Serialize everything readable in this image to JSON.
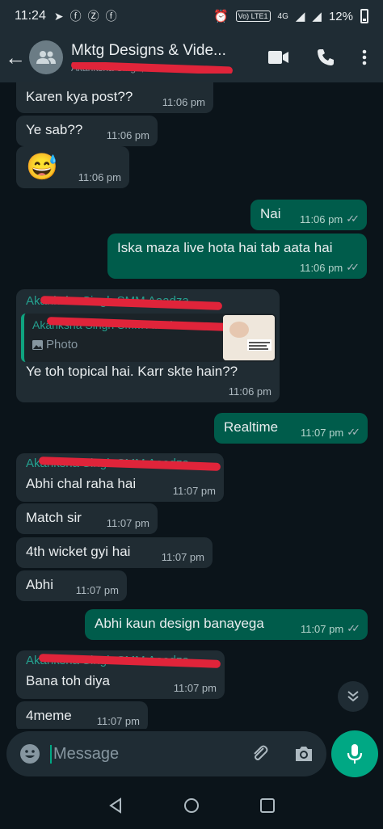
{
  "status_bar": {
    "time": "11:24",
    "network": "4G",
    "volte": "Vo) LTE1",
    "battery": "12%"
  },
  "header": {
    "title": "Mktg Designs & Vide...",
    "subtitle": "Akanksha Singh, ..."
  },
  "quote": {
    "name": "Akanksha Singh SMM Aaadza",
    "photo_label": "Photo"
  },
  "messages": [
    {
      "dir": "in",
      "text": "Karen kya post??",
      "time": "11:06 pm"
    },
    {
      "dir": "in",
      "text": "Ye sab??",
      "time": "11:06 pm"
    },
    {
      "dir": "in",
      "text": "😅",
      "time": "11:06 pm"
    },
    {
      "dir": "out",
      "text": "Nai",
      "time": "11:06 pm"
    },
    {
      "dir": "out",
      "text": "Iska maza live hota hai tab aata hai",
      "time": "11:06 pm"
    },
    {
      "dir": "in",
      "sender": "Akanksha Singh SMM Aaadza",
      "text": "Ye toh topical hai. Karr skte hain??",
      "time": "11:06 pm"
    },
    {
      "dir": "out",
      "text": "Realtime",
      "time": "11:07 pm"
    },
    {
      "dir": "in",
      "sender": "Akanksha Singh SMM Aaadza",
      "text": "Abhi chal raha hai",
      "time": "11:07 pm"
    },
    {
      "dir": "in",
      "text": "Match sir",
      "time": "11:07 pm"
    },
    {
      "dir": "in",
      "text": "4th wicket gyi hai",
      "time": "11:07 pm"
    },
    {
      "dir": "in",
      "text": "Abhi",
      "time": "11:07 pm"
    },
    {
      "dir": "out",
      "text": "Abhi kaun design banayega",
      "time": "11:07 pm"
    },
    {
      "dir": "in",
      "sender": "Akanksha Singh SMM Aaadza",
      "text": "Bana toh diya",
      "time": "11:07 pm"
    },
    {
      "dir": "in",
      "text": "4meme",
      "time": "11:07 pm"
    }
  ],
  "composer": {
    "placeholder": "Message"
  },
  "colors": {
    "incoming": "#202c33",
    "outgoing": "#005c4b",
    "accent": "#00a884",
    "background": "#0b141a"
  }
}
